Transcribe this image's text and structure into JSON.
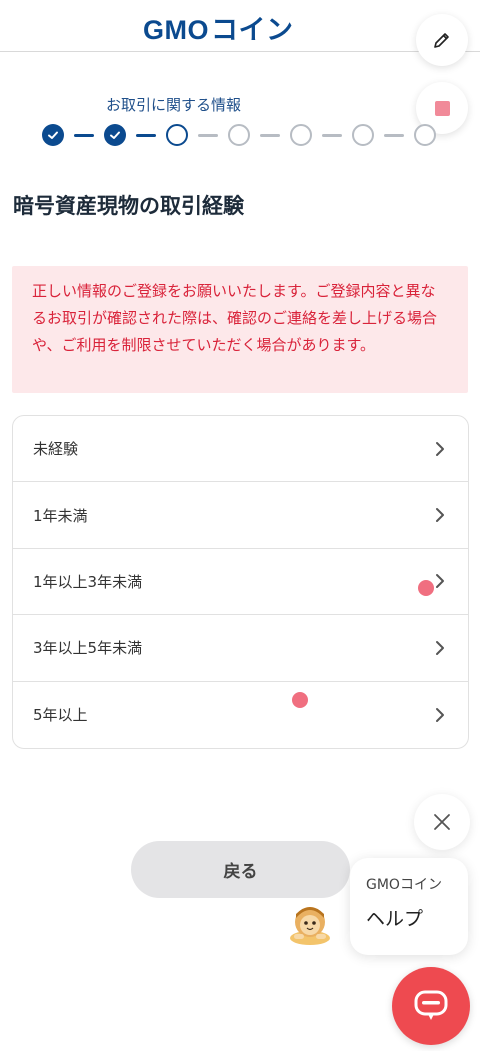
{
  "header": {
    "logo_text": "GMO",
    "logo_coin_text": "コイン"
  },
  "stepper": {
    "label": "お取引に関する情報",
    "steps": [
      "done",
      "done",
      "current",
      "todo",
      "todo",
      "todo",
      "todo"
    ],
    "accent_color": "#0b4a8f",
    "inactive_color": "#b7bcc3"
  },
  "main": {
    "title": "暗号資産現物の取引経験",
    "alert_text": "正しい情報のご登録をお願いいたします。ご登録内容と異なるお取引が確認された際は、確認のご連絡を差し上げる場合や、ご利用を制限させていただく場合があります。",
    "options": [
      {
        "label": "未経験"
      },
      {
        "label": "1年未満"
      },
      {
        "label": "1年以上3年未満"
      },
      {
        "label": "3年以上5年未満"
      },
      {
        "label": "5年以上"
      }
    ],
    "back_label": "戻る"
  },
  "help": {
    "brand": "GMOコイン",
    "label": "ヘルプ"
  },
  "icons": {
    "edit": "pencil-icon",
    "stop": "stop-square-icon",
    "close": "close-icon",
    "chat": "chat-bubble-icon",
    "chevron": "chevron-right-icon"
  },
  "colors": {
    "alert_bg": "#fde8ea",
    "alert_text": "#d9233a",
    "chat_fab": "#ee4a50"
  }
}
